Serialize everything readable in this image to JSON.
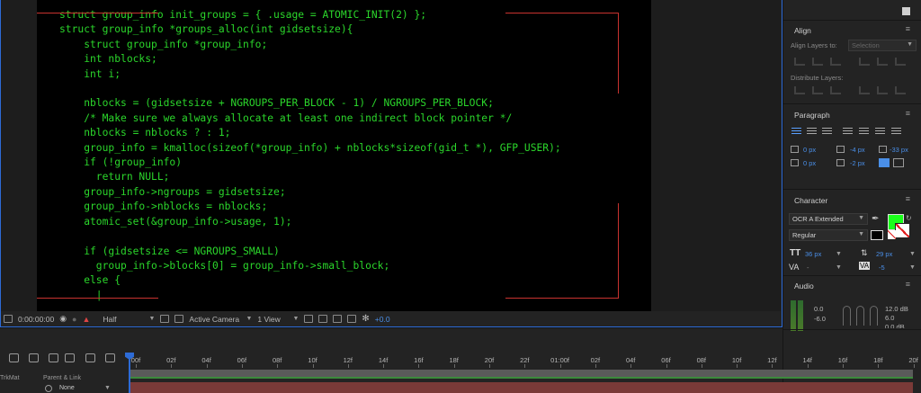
{
  "code_lines": [
    "struct group_info init_groups = { .usage = ATOMIC_INIT(2) };",
    "struct group_info *groups_alloc(int gidsetsize){",
    "    struct group_info *group_info;",
    "    int nblocks;",
    "    int i;",
    "",
    "    nblocks = (gidsetsize + NGROUPS_PER_BLOCK - 1) / NGROUPS_PER_BLOCK;",
    "    /* Make sure we always allocate at least one indirect block pointer */",
    "    nblocks = nblocks ? : 1;",
    "    group_info = kmalloc(sizeof(*group_info) + nblocks*sizeof(gid_t *), GFP_USER);",
    "    if (!group_info)",
    "      return NULL;",
    "    group_info->ngroups = gidsetsize;",
    "    group_info->nblocks = nblocks;",
    "    atomic_set(&group_info->usage, 1);",
    "",
    "    if (gidsetsize <= NGROUPS_SMALL)",
    "      group_info->blocks[0] = group_info->small_block;",
    "    else {",
    "      |"
  ],
  "viewer_toolbar": {
    "timecode": "0:00:00:00",
    "resolution": "Half",
    "camera": "Active Camera",
    "view": "1 View",
    "exposure": "+0.0"
  },
  "align_panel": {
    "title": "Align",
    "align_layers_to_label": "Align Layers to:",
    "align_layers_to_value": "Selection",
    "distribute_label": "Distribute Layers:"
  },
  "paragraph_panel": {
    "title": "Paragraph",
    "indent_left": "0 px",
    "indent_right": "0 px",
    "space_before": "-4 px",
    "space_after": "-2 px",
    "first_line": "-33 px"
  },
  "character_panel": {
    "title": "Character",
    "font_family": "OCR A Extended",
    "font_style": "Regular",
    "font_size": "36 px",
    "leading": "29 px",
    "kerning": "-",
    "tracking": "-5",
    "fill_color": "#1aff1a"
  },
  "audio_panel": {
    "title": "Audio",
    "left_labels": [
      "0.0",
      "-6.0"
    ],
    "right_labels": [
      "12.0 dB",
      "6.0",
      "0.0 dB"
    ]
  },
  "timeline": {
    "ruler_labels": [
      "00f",
      "02f",
      "04f",
      "06f",
      "08f",
      "10f",
      "12f",
      "14f",
      "16f",
      "18f",
      "20f",
      "22f",
      "01:00f",
      "02f",
      "04f",
      "06f",
      "08f",
      "10f",
      "12f",
      "14f",
      "16f",
      "18f",
      "20f"
    ],
    "col_trkmat": "TrkMat",
    "col_parent": "Parent & Link",
    "parent_value": "None"
  }
}
